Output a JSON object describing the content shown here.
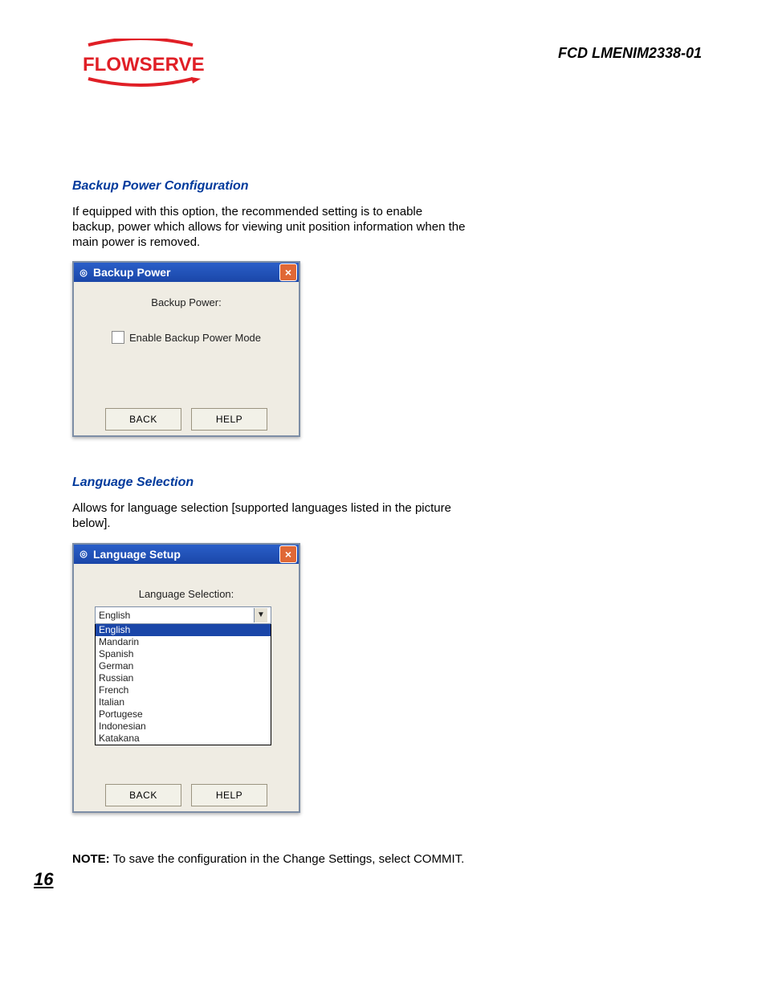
{
  "header": {
    "logo_text": "FLOWSERVE",
    "doc_id": "FCD LMENIM2338-01"
  },
  "section1": {
    "title": "Backup Power Configuration",
    "body": "If equipped with this option, the recommended setting is to enable backup, power which allows for viewing unit position information when the main power is removed."
  },
  "dialog_backup": {
    "title": "Backup Power",
    "close": "×",
    "label": "Backup Power:",
    "checkbox_label": "Enable Backup Power Mode",
    "back": "BACK",
    "help": "HELP"
  },
  "section2": {
    "title": "Language Selection",
    "body": "Allows for language selection [supported languages listed in the picture below]."
  },
  "dialog_language": {
    "title": "Language Setup",
    "close": "×",
    "label": "Language Selection:",
    "selected": "English",
    "options": [
      "English",
      "Mandarin",
      "Spanish",
      "German",
      "Russian",
      "French",
      "Italian",
      "Portugese",
      "Indonesian",
      "Katakana"
    ],
    "back": "BACK",
    "help": "HELP"
  },
  "note": {
    "label": "NOTE:",
    "text": " To save the configuration in the Change Settings, select COMMIT."
  },
  "page_number": "16"
}
